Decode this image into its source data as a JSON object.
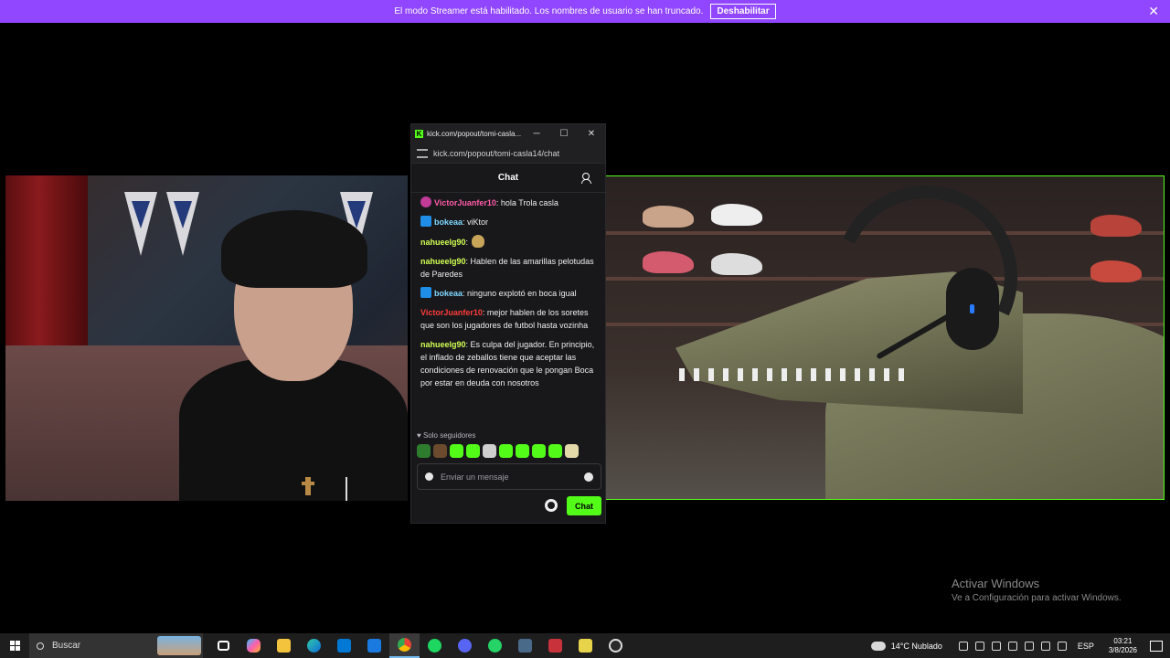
{
  "banner": {
    "message": "El modo Streamer está habilitado. Los nombres de usuario se han truncado.",
    "button_label": "Deshabilitar",
    "close_glyph": "✕",
    "color": "#9146ff"
  },
  "popout": {
    "window_title": "kick.com/popout/tomi-casla...",
    "url": "kick.com/popout/tomi-casla14/chat",
    "chat_header": "Chat",
    "minimize_glyph": "─",
    "maximize_glyph": "☐",
    "close_glyph": "✕",
    "messages": [
      {
        "badge": "sub",
        "user": "VictorJuanfer10",
        "user_color": "#ff5ca8",
        "text": " hola Trola casla"
      },
      {
        "badge": "arrow",
        "user": "bokeaa",
        "user_color": "#7fd7ff",
        "text": " viKtor"
      },
      {
        "badge": "",
        "user": "nahueelg90",
        "user_color": "#d2ff52",
        "text": "",
        "emote": true
      },
      {
        "badge": "",
        "user": "nahueelg90",
        "user_color": "#d2ff52",
        "text": " Hablen de las amarillas pelotudas de Paredes"
      },
      {
        "badge": "arrow",
        "user": "bokeaa",
        "user_color": "#7fd7ff",
        "text": " ninguno explotó en boca igual"
      },
      {
        "badge": "",
        "user": "VictorJuanfer10",
        "user_color": "#ff3b3b",
        "text": " mejor hablen de los soretes que son los jugadores de futbol hasta vozinha"
      },
      {
        "badge": "",
        "user": "nahueelg90",
        "user_color": "#d2ff52",
        "text": " Es culpa del jugador. En principio, el inflado de zeballos tiene que aceptar las condiciones de renovación que le pongan Boca por estar en deuda con nosotros"
      }
    ],
    "followers_only": "♥ Solo seguidores",
    "input_placeholder": "Enviar un mensaje",
    "send_label": "Chat",
    "accent": "#53fc18"
  },
  "watermark": {
    "line1": "Activar Windows",
    "line2": "Ve a Configuración para activar Windows."
  },
  "taskbar": {
    "search_placeholder": "Buscar",
    "weather": "14°C  Nublado",
    "language": "ESP",
    "time": "03:21",
    "date": "3/8/2026"
  }
}
